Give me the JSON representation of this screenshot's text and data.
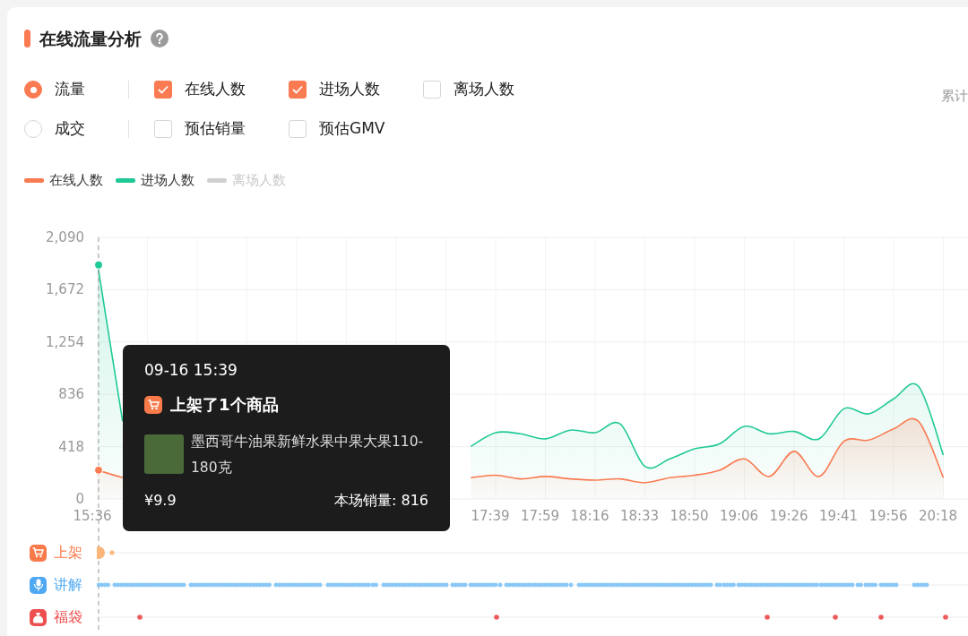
{
  "panel": {
    "title": "在线流量分析"
  },
  "metric_rows": [
    {
      "radio": {
        "label": "流量",
        "selected": true
      },
      "checkboxes": [
        {
          "label": "在线人数",
          "checked": true
        },
        {
          "label": "进场人数",
          "checked": true
        },
        {
          "label": "离场人数",
          "checked": false
        }
      ]
    },
    {
      "radio": {
        "label": "成交",
        "selected": false
      },
      "checkboxes": [
        {
          "label": "预估销量",
          "checked": false
        },
        {
          "label": "预估GMV",
          "checked": false
        }
      ]
    }
  ],
  "cumulative_label": "累计",
  "legend": [
    {
      "selected": true
    },
    {
      "selected": true
    },
    {
      "label": "离场人数",
      "selected": false
    }
  ],
  "chart": {
    "chart_data": {
      "type": "area",
      "grid": true,
      "categories": [
        "15:36",
        null,
        null,
        null,
        null,
        null,
        null,
        null,
        null,
        null,
        null,
        null,
        null,
        null,
        null,
        null,
        "17:39",
        null,
        "17:59",
        null,
        "18:16",
        null,
        "18:33",
        null,
        "18:50",
        null,
        "19:06",
        null,
        "19:26",
        null,
        "19:41",
        null,
        "19:56",
        null,
        "20:18"
      ],
      "series": [
        {
          "name": "在线人数",
          "color": "#f97b52",
          "values": [
            230,
            170,
            null,
            null,
            null,
            null,
            null,
            null,
            null,
            null,
            null,
            null,
            null,
            null,
            null,
            170,
            190,
            160,
            180,
            160,
            150,
            160,
            130,
            170,
            190,
            230,
            320,
            180,
            380,
            180,
            460,
            470,
            560,
            620,
            170
          ]
        },
        {
          "name": "进场人数",
          "color": "#1fc996",
          "values": [
            1870,
            620,
            null,
            null,
            null,
            null,
            null,
            null,
            null,
            null,
            null,
            null,
            null,
            null,
            null,
            420,
            530,
            520,
            480,
            550,
            530,
            600,
            260,
            320,
            400,
            440,
            580,
            520,
            540,
            480,
            720,
            680,
            800,
            900,
            350
          ]
        }
      ],
      "ylim": [
        0,
        2090
      ],
      "yticks": [
        {
          "value": 0,
          "label": "0"
        },
        {
          "value": 418,
          "label": "418"
        },
        {
          "value": 836,
          "label": "836"
        },
        {
          "value": 1254,
          "label": "1,254"
        },
        {
          "value": 1672,
          "label": "1,672"
        },
        {
          "value": 2090,
          "label": "2,090"
        }
      ]
    }
  },
  "tooltip": {
    "datetime": "09-16 15:39",
    "title": "上架了1个商品",
    "product_name": "墨西哥牛油果新鲜水果中果大果110-180克",
    "price": "¥9.9",
    "sales": "本场销量: 816"
  },
  "events": [
    {
      "kind": "listing",
      "label": "上架",
      "color": "#f87a4a"
    },
    {
      "kind": "explain",
      "label": "讲解",
      "color": "#4fa9f2"
    },
    {
      "kind": "lucky_bag",
      "label": "福袋",
      "color": "#ee4f4f"
    }
  ]
}
